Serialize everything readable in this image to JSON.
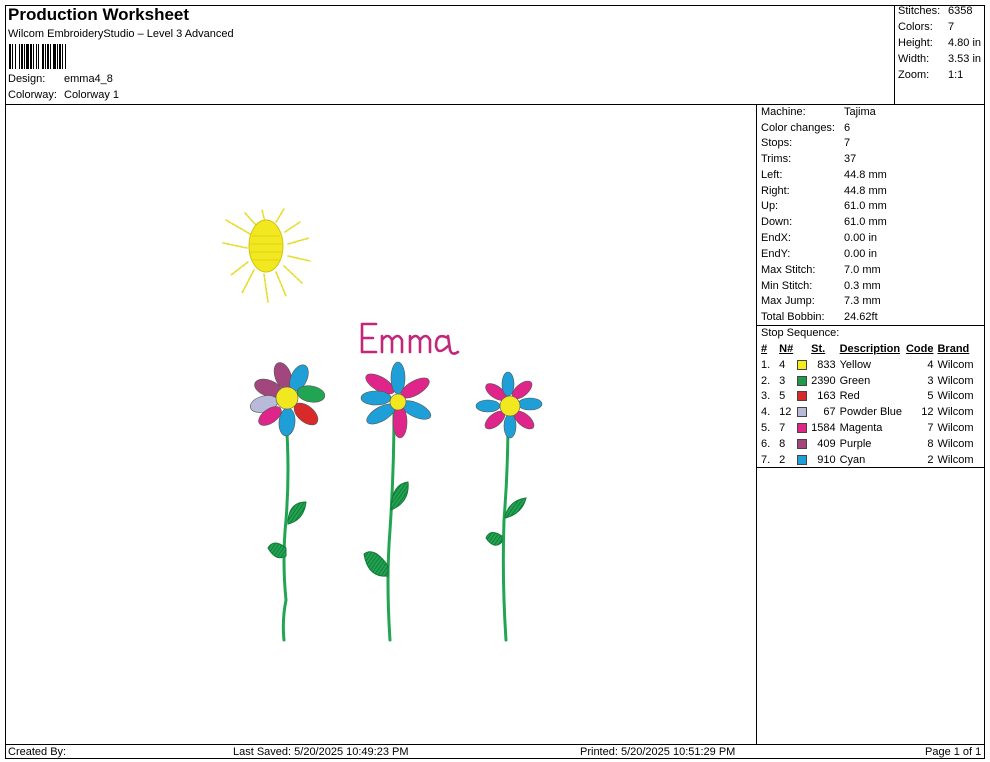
{
  "header": {
    "title": "Production Worksheet",
    "software": "Wilcom EmbroideryStudio – Level 3 Advanced",
    "design_label": "Design:",
    "design_value": "emma4_8",
    "colorway_label": "Colorway:",
    "colorway_value": "Colorway 1"
  },
  "summary": {
    "stitches_label": "Stitches:",
    "stitches_value": "6358",
    "colors_label": "Colors:",
    "colors_value": "7",
    "height_label": "Height:",
    "height_value": "4.80 in",
    "width_label": "Width:",
    "width_value": "3.53 in",
    "zoom_label": "Zoom:",
    "zoom_value": "1:1"
  },
  "machine": {
    "rows": [
      {
        "k": "Machine:",
        "v": "Tajima"
      },
      {
        "k": "Color changes:",
        "v": "6"
      },
      {
        "k": "Stops:",
        "v": "7"
      },
      {
        "k": "Trims:",
        "v": "37"
      },
      {
        "k": "Left:",
        "v": "44.8 mm"
      },
      {
        "k": "Right:",
        "v": "44.8 mm"
      },
      {
        "k": "Up:",
        "v": "61.0 mm"
      },
      {
        "k": "Down:",
        "v": "61.0 mm"
      },
      {
        "k": "EndX:",
        "v": "0.00 in"
      },
      {
        "k": "EndY:",
        "v": "0.00 in"
      },
      {
        "k": "Max Stitch:",
        "v": "7.0 mm"
      },
      {
        "k": "Min Stitch:",
        "v": "0.3 mm"
      },
      {
        "k": "Max Jump:",
        "v": "7.3 mm"
      },
      {
        "k": "Total Bobbin:",
        "v": "24.62ft"
      }
    ]
  },
  "stop_sequence": {
    "title": "Stop Sequence:",
    "headers": [
      "#",
      "N#",
      "St.",
      "Description",
      "Code",
      "Brand"
    ],
    "rows": [
      {
        "idx": "1.",
        "n": "4",
        "color": "#f5ec1e",
        "st": "833",
        "desc": "Yellow",
        "code": "4",
        "brand": "Wilcom"
      },
      {
        "idx": "2.",
        "n": "3",
        "color": "#1f9a4a",
        "st": "2390",
        "desc": "Green",
        "code": "3",
        "brand": "Wilcom"
      },
      {
        "idx": "3.",
        "n": "5",
        "color": "#d92a2a",
        "st": "163",
        "desc": "Red",
        "code": "5",
        "brand": "Wilcom"
      },
      {
        "idx": "4.",
        "n": "12",
        "color": "#b9b9d9",
        "st": "67",
        "desc": "Powder Blue",
        "code": "12",
        "brand": "Wilcom"
      },
      {
        "idx": "5.",
        "n": "7",
        "color": "#e0258a",
        "st": "1584",
        "desc": "Magenta",
        "code": "7",
        "brand": "Wilcom"
      },
      {
        "idx": "6.",
        "n": "8",
        "color": "#a4467e",
        "st": "409",
        "desc": "Purple",
        "code": "8",
        "brand": "Wilcom"
      },
      {
        "idx": "7.",
        "n": "2",
        "color": "#1e9fd8",
        "st": "910",
        "desc": "Cyan",
        "code": "2",
        "brand": "Wilcom"
      }
    ]
  },
  "design": {
    "name_text": "Emma"
  },
  "footer": {
    "created_by": "Created By:",
    "last_saved": "Last Saved: 5/20/2025 10:49:23 PM",
    "printed": "Printed: 5/20/2025 10:51:29 PM",
    "page": "Page 1 of 1"
  }
}
